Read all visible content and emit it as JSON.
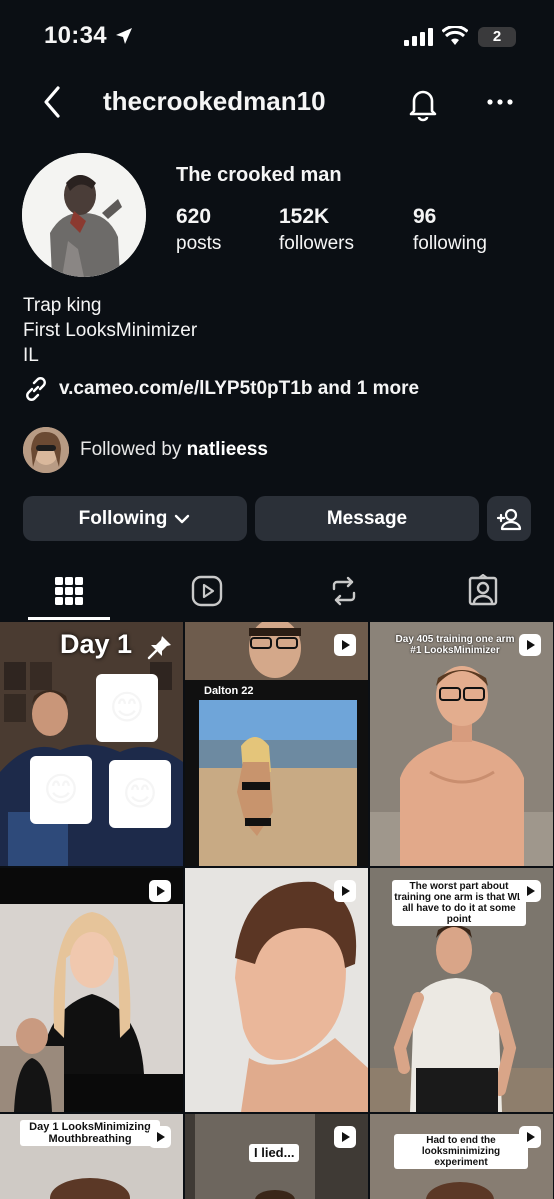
{
  "status_bar": {
    "time": "10:34",
    "battery": "2"
  },
  "header": {
    "username": "thecrookedman10"
  },
  "profile": {
    "display_name": "The crooked man",
    "stats": [
      {
        "value": "620",
        "label": "posts"
      },
      {
        "value": "152K",
        "label": "followers"
      },
      {
        "value": "96",
        "label": "following"
      }
    ],
    "bio": [
      "Trap king",
      "First LooksMinimizer",
      "IL"
    ],
    "link": "v.cameo.com/e/lLYP5t0pT1b and 1 more",
    "followed_by_prefix": "Followed by ",
    "followed_by_name": "natlieess"
  },
  "actions": {
    "following": "Following",
    "message": "Message"
  },
  "icons": {
    "back": "chevron-left-icon",
    "bell": "bell-icon",
    "more": "more-horizontal-icon",
    "link": "link-icon",
    "add_person": "add-person-icon",
    "grid": "grid-icon",
    "reels": "reels-icon",
    "reposts": "repost-icon",
    "tagged": "tagged-icon"
  },
  "posts": [
    {
      "caption": "Day 1",
      "pinned": true,
      "reel": false
    },
    {
      "caption": "Dalton 22",
      "reel": true
    },
    {
      "caption": "Day 405 training one arm #1 LooksMinimizer",
      "reel": true
    },
    {
      "caption": "",
      "reel": true
    },
    {
      "caption": "",
      "reel": true
    },
    {
      "caption": "The worst part about training one arm is that WE all have to do it at some point",
      "reel": true
    },
    {
      "caption": "Day 1 LooksMinimizing Mouthbreathing",
      "reel": true
    },
    {
      "caption": "I lied...",
      "reel": true
    },
    {
      "caption": "Had to end the looksminimizing experiment",
      "reel": true
    }
  ],
  "colors": {
    "background": "#0b0f14",
    "button": "#2b3038",
    "text": "#f5f5f5"
  }
}
